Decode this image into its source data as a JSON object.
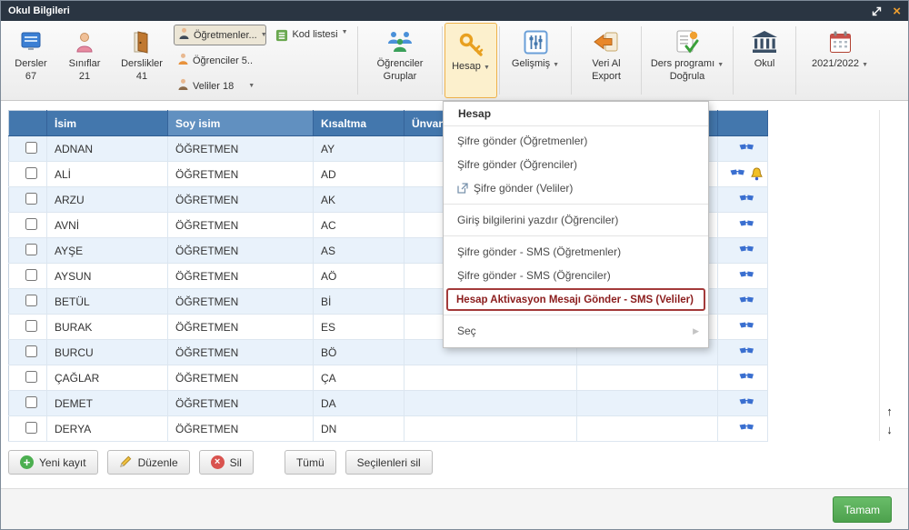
{
  "window": {
    "title": "Okul Bilgileri"
  },
  "icons": {
    "caret": "▼",
    "submenu": "▶",
    "close": "×",
    "scroll_up": "↑",
    "scroll_down": "↓"
  },
  "toolbar": {
    "dersler": {
      "label": "Dersler",
      "count": "67"
    },
    "siniflar": {
      "label": "Sınıflar",
      "count": "21"
    },
    "derslikler": {
      "label": "Derslikler",
      "count": "41"
    },
    "ogretmenler": "Öğretmenler...",
    "ogrenciler": "Öğrenciler 5..",
    "veliler": "Veliler 18",
    "kod_listesi": "Kod listesi",
    "gruplar": {
      "line1": "Öğrenciler",
      "line2": "Gruplar"
    },
    "hesap": "Hesap",
    "gelismis": "Gelişmiş",
    "veri_al": {
      "line1": "Veri Al",
      "line2": "Export"
    },
    "ders_programi": {
      "line1": "Ders programı",
      "line2": "Doğrula"
    },
    "okul": "Okul",
    "year": "2021/2022"
  },
  "menu": {
    "header": "Hesap",
    "items": [
      {
        "label": "Şifre gönder (Öğretmenler)"
      },
      {
        "label": "Şifre gönder (Öğrenciler)"
      },
      {
        "label": "Şifre gönder (Veliler)",
        "icon": "external-link-icon"
      },
      {
        "label": "Giriş bilgilerini yazdır (Öğrenciler)",
        "separator_before": true
      },
      {
        "label": "Şifre gönder - SMS (Öğretmenler)",
        "separator_before": true
      },
      {
        "label": "Şifre gönder - SMS (Öğrenciler)"
      },
      {
        "label": "Hesap Aktivasyon Mesajı Gönder - SMS (Veliler)",
        "highlighted": true
      },
      {
        "label": "Seç",
        "separator_before": true,
        "submenu": true
      }
    ]
  },
  "table": {
    "headers": [
      "İsim",
      "Soy isim",
      "Kısaltma",
      "Ünvan"
    ],
    "rows": [
      {
        "isim": "ADNAN",
        "soy_isim": "ÖĞRETMEN",
        "kisaltma": "AY",
        "bell": false
      },
      {
        "isim": "ALİ",
        "soy_isim": "ÖĞRETMEN",
        "kisaltma": "AD",
        "bell": true
      },
      {
        "isim": "ARZU",
        "soy_isim": "ÖĞRETMEN",
        "kisaltma": "AK",
        "bell": false
      },
      {
        "isim": "AVNİ",
        "soy_isim": "ÖĞRETMEN",
        "kisaltma": "AC",
        "bell": false
      },
      {
        "isim": "AYŞE",
        "soy_isim": "ÖĞRETMEN",
        "kisaltma": "AS",
        "bell": false
      },
      {
        "isim": "AYSUN",
        "soy_isim": "ÖĞRETMEN",
        "kisaltma": "AÖ",
        "bell": false
      },
      {
        "isim": "BETÜL",
        "soy_isim": "ÖĞRETMEN",
        "kisaltma": "Bİ",
        "bell": false
      },
      {
        "isim": "BURAK",
        "soy_isim": "ÖĞRETMEN",
        "kisaltma": "ES",
        "bell": false
      },
      {
        "isim": "BURCU",
        "soy_isim": "ÖĞRETMEN",
        "kisaltma": "BÖ",
        "bell": false
      },
      {
        "isim": "ÇAĞLAR",
        "soy_isim": "ÖĞRETMEN",
        "kisaltma": "ÇA",
        "bell": false
      },
      {
        "isim": "DEMET",
        "soy_isim": "ÖĞRETMEN",
        "kisaltma": "DA",
        "bell": false
      },
      {
        "isim": "DERYA",
        "soy_isim": "ÖĞRETMEN",
        "kisaltma": "DN",
        "bell": false
      }
    ]
  },
  "footer": {
    "yeni_kayit": "Yeni kayıt",
    "duzenle": "Düzenle",
    "sil": "Sil",
    "tumu": "Tümü",
    "secilenleri_sil": "Seçilenleri sil"
  },
  "dialog": {
    "ok_label": "Tamam"
  },
  "colors": {
    "titlebar": "#2a3542",
    "header_blue": "#4377ad",
    "header_sorted_blue": "#6190c0",
    "row_alt": "#e9f2fb",
    "menu_highlight_border": "#a33a3a",
    "hesap_active_bg": "#fcf0cd",
    "hesap_active_border": "#efb24a",
    "ok_green": "#55ab55",
    "close_orange": "#f0a030"
  }
}
